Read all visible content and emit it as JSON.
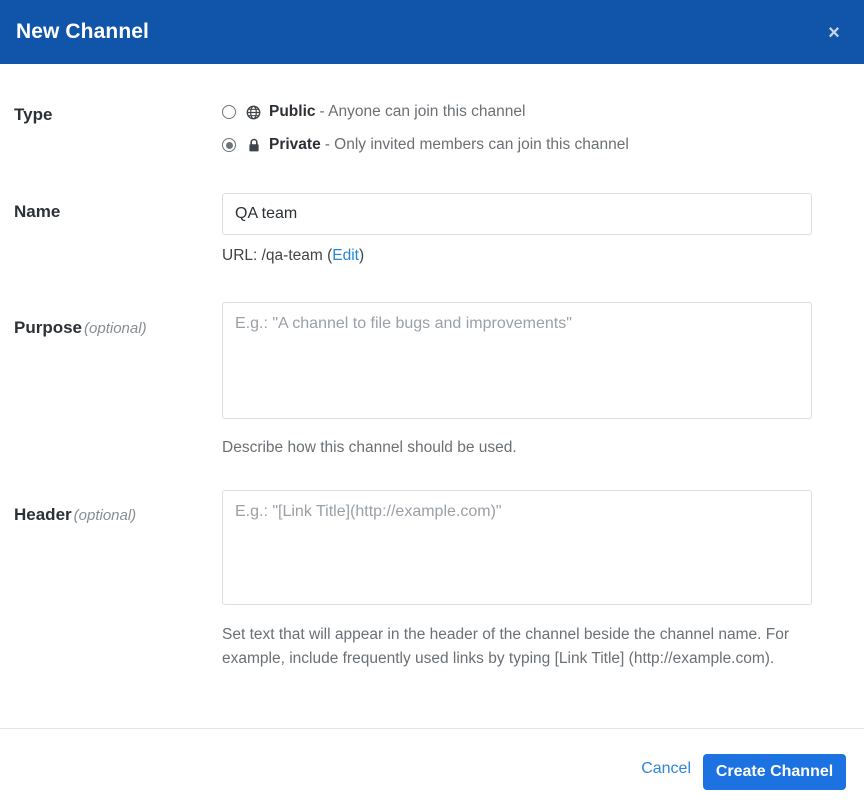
{
  "dialog": {
    "title": "New Channel",
    "close_label": "×"
  },
  "form": {
    "type": {
      "label": "Type",
      "options": [
        {
          "icon": "globe-icon",
          "name": "Public",
          "description": "- Anyone can join this channel",
          "selected": false
        },
        {
          "icon": "lock-icon",
          "name": "Private",
          "description": "- Only invited members can join this channel",
          "selected": true
        }
      ]
    },
    "name": {
      "label": "Name",
      "value": "QA team",
      "placeholder": "",
      "url_prefix": "URL: /qa-team (",
      "url_edit_label": "Edit",
      "url_suffix": ")"
    },
    "purpose": {
      "label": "Purpose",
      "optional": "(optional)",
      "value": "",
      "placeholder": "E.g.: \"A channel to file bugs and improvements\"",
      "help": "Describe how this channel should be used."
    },
    "header": {
      "label": "Header",
      "optional": "(optional)",
      "value": "",
      "placeholder": "E.g.: \"[Link Title](http://example.com)\"",
      "help": "Set text that will appear in the header of the channel beside the channel name. For example, include frequently used links by typing [Link Title] (http://example.com)."
    }
  },
  "footer": {
    "cancel_label": "Cancel",
    "create_label": "Create Channel"
  },
  "colors": {
    "header_bg": "#1155ab",
    "primary_button": "#1b72e0",
    "link": "#2389d7"
  }
}
